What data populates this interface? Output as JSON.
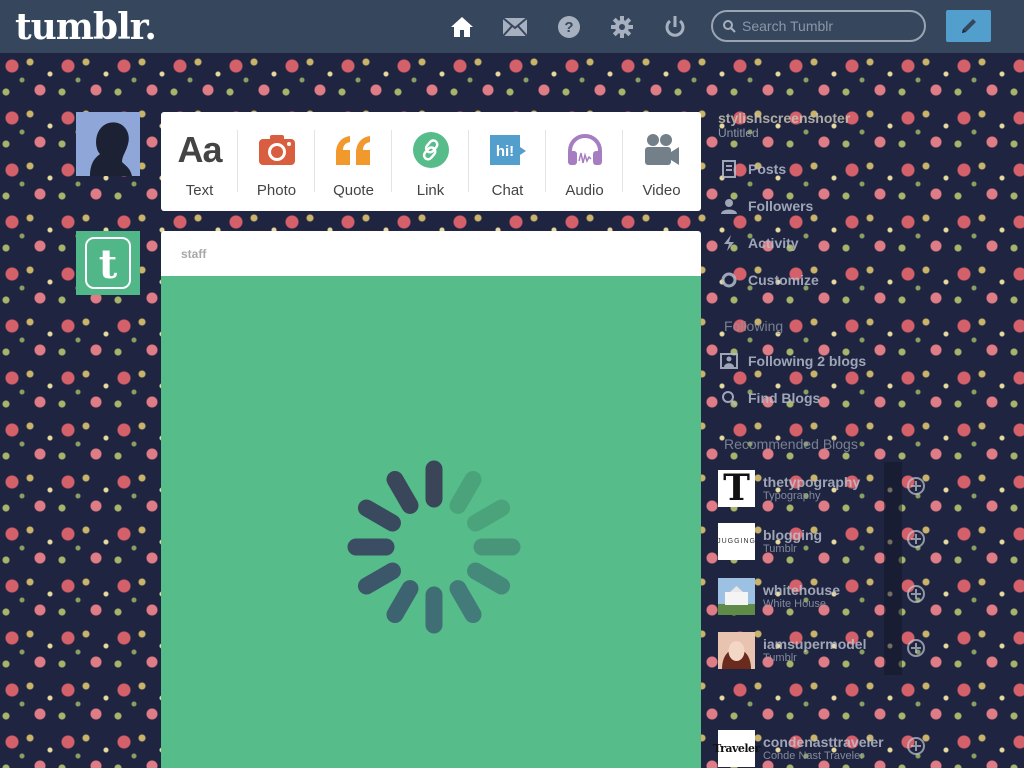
{
  "header": {
    "logo": "tumblr.",
    "search_placeholder": "Search Tumblr",
    "nav": [
      "home-icon",
      "mail-icon",
      "help-icon",
      "gear-icon",
      "power-icon"
    ],
    "compose": "pencil-icon"
  },
  "post_types": [
    {
      "label": "Text",
      "color": "#444444"
    },
    {
      "label": "Photo",
      "color": "#d95e40"
    },
    {
      "label": "Quote",
      "color": "#f2992e"
    },
    {
      "label": "Link",
      "color": "#56bc8a"
    },
    {
      "label": "Chat",
      "color": "#529ecc"
    },
    {
      "label": "Audio",
      "color": "#a77dc2"
    },
    {
      "label": "Video",
      "color": "#748089"
    }
  ],
  "post": {
    "blog_name": "staff",
    "body_color": "#56bc8a"
  },
  "sidebar": {
    "account": "stylishscreenshoter",
    "account_sub": "Untitled",
    "items": [
      {
        "label": "Posts",
        "icon": "posts-icon"
      },
      {
        "label": "Followers",
        "icon": "followers-icon"
      },
      {
        "label": "Activity",
        "icon": "activity-icon"
      },
      {
        "label": "Customize",
        "icon": "customize-icon"
      }
    ],
    "section_label": "Following",
    "following_item": "Following 2 blogs",
    "find_blogs": "Find Blogs",
    "recommended_label": "Recommended Blogs",
    "blogs": [
      {
        "name": "thetypography",
        "sub": "Typography"
      },
      {
        "name": "blogging",
        "sub": "Tumblr"
      },
      {
        "name": "whitehouse",
        "sub": "White House"
      },
      {
        "name": "iamsupermodel",
        "sub": "Tumblr"
      },
      {
        "name": "condenasttraveler",
        "sub": "Conde Nast Traveler"
      }
    ]
  }
}
